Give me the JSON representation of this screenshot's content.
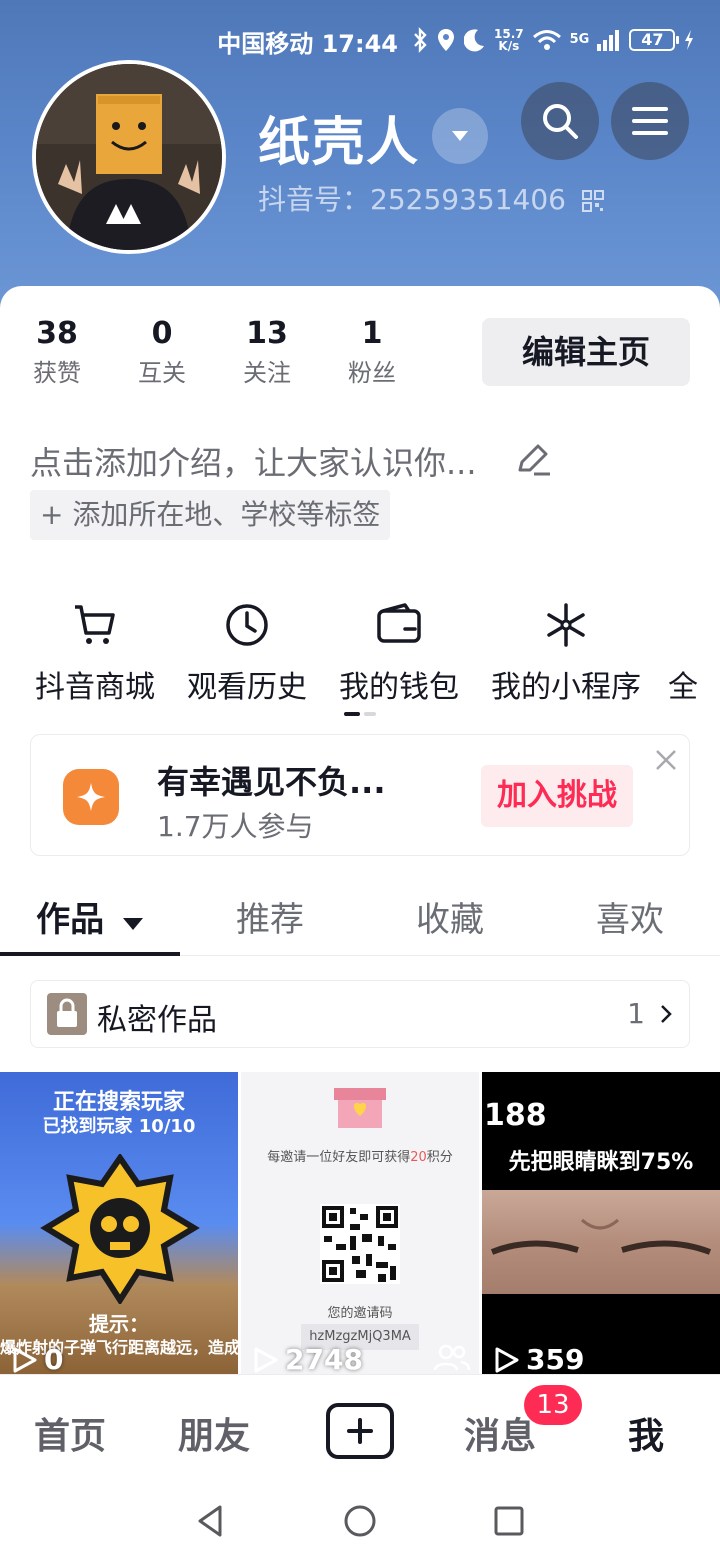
{
  "status_bar": {
    "carrier_time": "中国移动 17:44",
    "net_speed_value": "15.7",
    "net_speed_unit": "K/s",
    "network": "5G",
    "battery": "47"
  },
  "profile": {
    "nickname": "纸壳人",
    "douyin_id": "抖音号：25259351406"
  },
  "stats": [
    {
      "num": "38",
      "label": "获赞"
    },
    {
      "num": "0",
      "label": "互关"
    },
    {
      "num": "13",
      "label": "关注"
    },
    {
      "num": "1",
      "label": "粉丝"
    }
  ],
  "edit_button": "编辑主页",
  "bio_placeholder": "点击添加介绍，让大家认识你...",
  "tag_button": "+ 添加所在地、学校等标签",
  "tools": [
    {
      "label": "抖音商城",
      "icon": "cart-icon"
    },
    {
      "label": "观看历史",
      "icon": "clock-icon"
    },
    {
      "label": "我的钱包",
      "icon": "wallet-icon"
    },
    {
      "label": "我的小程序",
      "icon": "mini-program-icon"
    },
    {
      "label": "全",
      "icon": "more-icon"
    }
  ],
  "promo": {
    "title": "有幸遇见不负...",
    "subtitle": "1.7万人参与",
    "button": "加入挑战"
  },
  "tabs": [
    "作品",
    "推荐",
    "收藏",
    "喜欢"
  ],
  "private_works": {
    "label": "私密作品",
    "count": "1"
  },
  "videos": [
    {
      "views": "0",
      "text_top": "正在搜索玩家",
      "text_sub": "已找到玩家 10/10",
      "text_hint": "提示：",
      "text_hint2": "爆炸射的子弹飞行距离越远，造成的伤害"
    },
    {
      "views": "2748",
      "text_invite": "每邀请一位好友即可获得",
      "points_value": "20",
      "points_suffix": "积分",
      "code_label": "您的邀请码",
      "code": "hzMzgzMjQ3MA"
    },
    {
      "views": "359",
      "text_num": "188",
      "text_caption": "先把眼睛眯到75%"
    }
  ],
  "bottom_nav": {
    "home": "首页",
    "friends": "朋友",
    "messages": "消息",
    "messages_badge": "13",
    "me": "我"
  }
}
